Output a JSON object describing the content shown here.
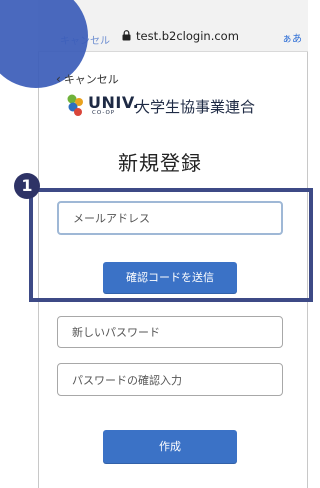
{
  "browser": {
    "back_text": "キャンセル",
    "domain": "test.b2clogin.com",
    "text_size_label": "ぁあ"
  },
  "cancel_link": {
    "chevron": "‹",
    "label": "キャンセル"
  },
  "logo": {
    "univ": "UNIV.",
    "coop": "CO-OP",
    "org": "大学生協事業連合"
  },
  "page": {
    "title": "新規登録"
  },
  "step": {
    "number": "1"
  },
  "form": {
    "email_placeholder": "メールアドレス",
    "send_code_label": "確認コードを送信",
    "new_password_placeholder": "新しいパスワード",
    "confirm_password_placeholder": "パスワードの確認入力",
    "create_label": "作成"
  },
  "colors": {
    "accent": "#3b72c6",
    "highlight": "#3d4a86",
    "badge": "#2e3366"
  }
}
